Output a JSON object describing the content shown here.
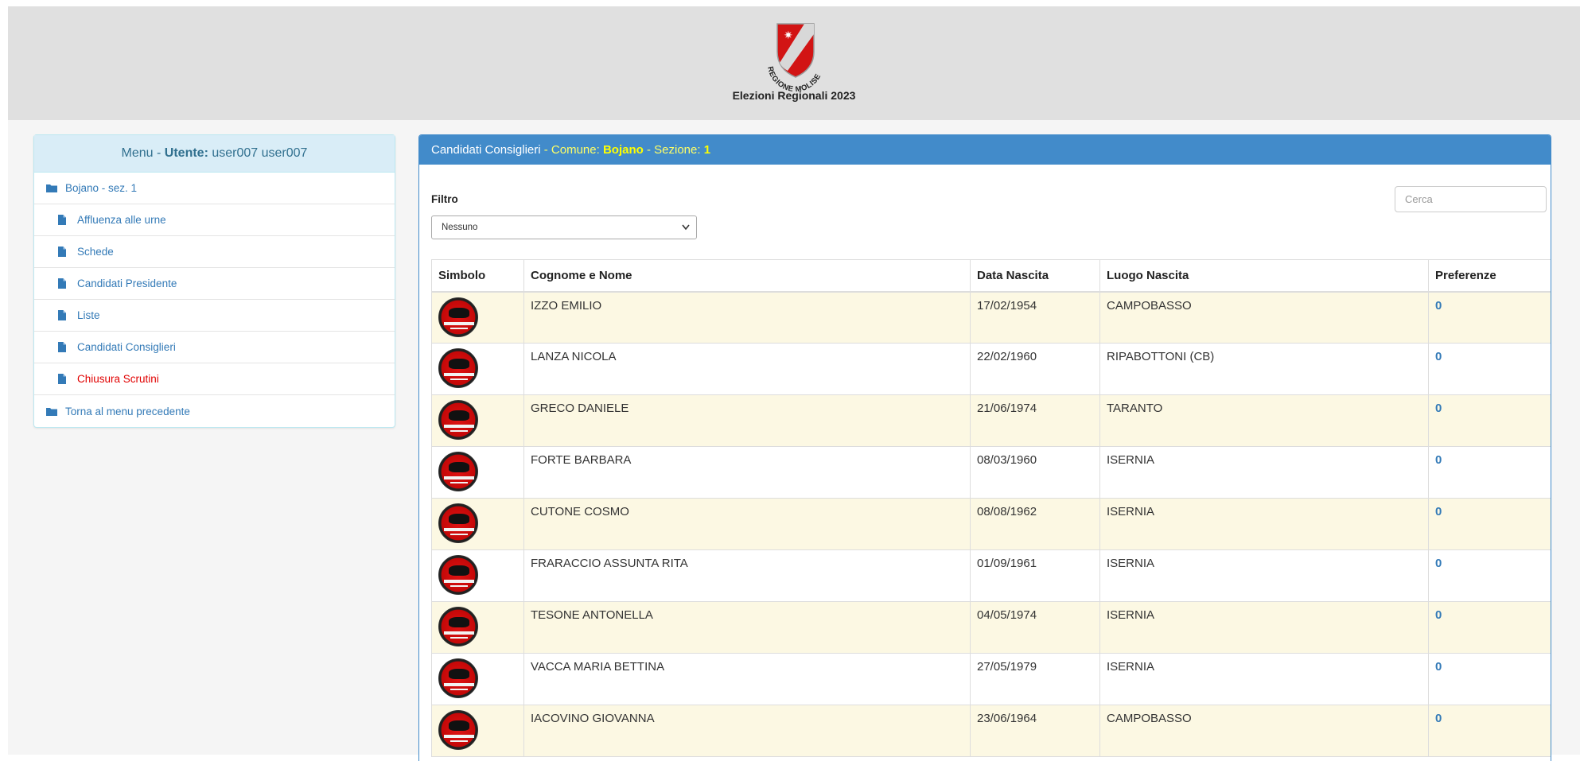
{
  "header": {
    "logo_text": "REGIONE MOLISE",
    "title": "Elezioni Regionali 2023"
  },
  "menu": {
    "prefix": "Menu - ",
    "user_label": "Utente:",
    "user_name": "user007 user007",
    "items": [
      {
        "label": "Bojano - sez. 1",
        "icon": "folder-icon",
        "level": 0
      },
      {
        "label": "Affluenza alle urne",
        "icon": "file-icon",
        "level": 1
      },
      {
        "label": "Schede",
        "icon": "file-icon",
        "level": 1
      },
      {
        "label": "Candidati Presidente",
        "icon": "file-icon",
        "level": 1
      },
      {
        "label": "Liste",
        "icon": "file-icon",
        "level": 1
      },
      {
        "label": "Candidati Consiglieri",
        "icon": "file-icon",
        "level": 1
      },
      {
        "label": "Chiusura Scrutini",
        "icon": "file-icon",
        "level": 1,
        "color": "#e10000"
      },
      {
        "label": "Torna al menu precedente",
        "icon": "folder-icon",
        "level": 0
      }
    ]
  },
  "panel": {
    "title": "Candidati Consiglieri",
    "sep1": " - ",
    "comune_label": "Comune: ",
    "comune_value": "Bojano",
    "sep2": " - ",
    "sezione_label": "Sezione: ",
    "sezione_value": "1",
    "filter_label": "Filtro",
    "filter_value": "Nessuno",
    "search_placeholder": "Cerca"
  },
  "table": {
    "headers": [
      "Simbolo",
      "Cognome e Nome",
      "Data Nascita",
      "Luogo Nascita",
      "Preferenze"
    ],
    "rows": [
      {
        "nome": "IZZO EMILIO",
        "data": "17/02/1954",
        "luogo": "CAMPOBASSO",
        "pref": "0"
      },
      {
        "nome": "LANZA NICOLA",
        "data": "22/02/1960",
        "luogo": "RIPABOTTONI (CB)",
        "pref": "0"
      },
      {
        "nome": "GRECO DANIELE",
        "data": "21/06/1974",
        "luogo": "TARANTO",
        "pref": "0"
      },
      {
        "nome": "FORTE BARBARA",
        "data": "08/03/1960",
        "luogo": "ISERNIA",
        "pref": "0"
      },
      {
        "nome": "CUTONE COSMO",
        "data": "08/08/1962",
        "luogo": "ISERNIA",
        "pref": "0"
      },
      {
        "nome": "FRARACCIO ASSUNTA RITA",
        "data": "01/09/1961",
        "luogo": "ISERNIA",
        "pref": "0"
      },
      {
        "nome": "TESONE ANTONELLA",
        "data": "04/05/1974",
        "luogo": "ISERNIA",
        "pref": "0"
      },
      {
        "nome": "VACCA MARIA BETTINA",
        "data": "27/05/1979",
        "luogo": "ISERNIA",
        "pref": "0"
      },
      {
        "nome": "IACOVINO GIOVANNA",
        "data": "23/06/1964",
        "luogo": "CAMPOBASSO",
        "pref": "0"
      }
    ]
  },
  "colors": {
    "panel_blue": "#428bca",
    "link_blue": "#337ab7",
    "menu_head_bg": "#d9edf7",
    "odd_row_bg": "#fcf8e3",
    "highlight_yellow": "#ffff00"
  }
}
